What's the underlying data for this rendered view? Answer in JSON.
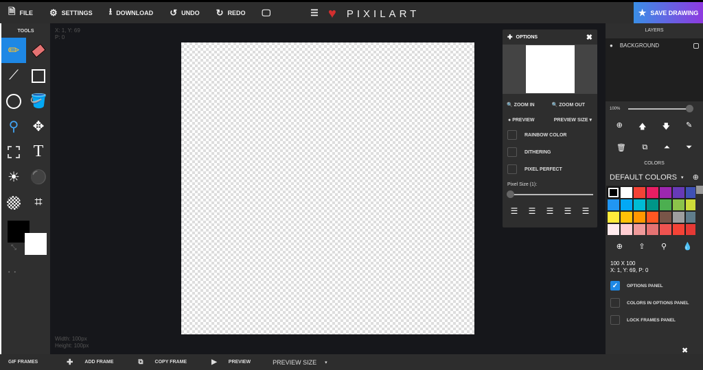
{
  "topbar": {
    "file": "FILE",
    "settings": "SETTINGS",
    "download": "DOWNLOAD",
    "undo": "UNDO",
    "redo": "REDO",
    "logo": "PIXILART",
    "save": "SAVE DRAWING"
  },
  "tools": {
    "title": "TOOLS",
    "items": [
      "pencil",
      "eraser",
      "line",
      "rectangle",
      "circle",
      "fill-bucket",
      "eyedropper",
      "move",
      "select",
      "text",
      "lighten",
      "stamp",
      "dither",
      "crop"
    ]
  },
  "canvas": {
    "coord_line1": "X: 1, Y: 69",
    "coord_line2": "P: 0",
    "width": "Width: 100px",
    "height": "Height: 100px"
  },
  "options": {
    "title": "OPTIONS",
    "zoom_in": "ZOOM IN",
    "zoom_out": "ZOOM OUT",
    "preview": "PREVIEW",
    "preview_size": "PREVIEW SIZE",
    "rainbow": "RAINBOW COLOR",
    "dithering": "DITHERING",
    "pixel_perfect": "PIXEL PERFECT",
    "pixel_size": "Pixel Size (1):",
    "pixel_size_value": 1
  },
  "right": {
    "layers_title": "LAYERS",
    "layer_name": "BACKGROUND",
    "opacity": "100%",
    "opacity_value": 100,
    "colors_title": "COLORS",
    "palette_name": "DEFAULT COLORS",
    "size": "100 X 100",
    "coords": "X: 1, Y: 69, P: 0",
    "checks": [
      {
        "label": "OPTIONS PANEL",
        "checked": true
      },
      {
        "label": "COLORS IN OPTIONS PANEL",
        "checked": false
      },
      {
        "label": "LOCK FRAMES PANEL",
        "checked": false
      }
    ],
    "palette": [
      "#000000",
      "#ffffff",
      "#f44336",
      "#e91e63",
      "#9c27b0",
      "#673ab7",
      "#3f51b5",
      "#2196f3",
      "#03a9f4",
      "#00bcd4",
      "#009688",
      "#4caf50",
      "#8bc34a",
      "#cddc39",
      "#ffeb3b",
      "#ffc107",
      "#ff9800",
      "#ff5722",
      "#795548",
      "#9e9e9e",
      "#607d8b",
      "#ffebee",
      "#ffcdd2",
      "#ef9a9a",
      "#e57373",
      "#ef5350",
      "#f44336",
      "#e53935"
    ]
  },
  "bottom": {
    "gif_frames": "GIF FRAMES",
    "add_frame": "ADD FRAME",
    "copy_frame": "COPY FRAME",
    "preview": "PREVIEW",
    "preview_size": "PREVIEW SIZE"
  }
}
